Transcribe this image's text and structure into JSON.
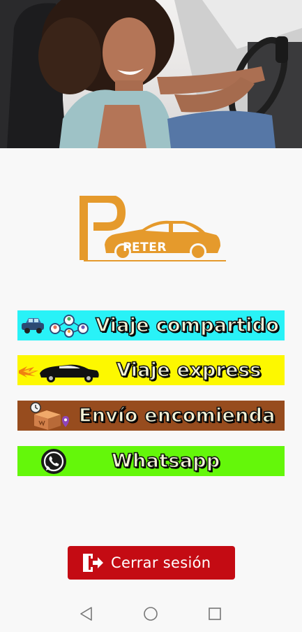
{
  "hero": {
    "image": "woman-driving-car-photo"
  },
  "logo": {
    "letter": "P",
    "text": "PETER",
    "color": "#e59a2c"
  },
  "menu": {
    "items": [
      {
        "label": "Viaje compartido",
        "icon": "shared-ride-icon",
        "color": "#29f2f7"
      },
      {
        "label": "Viaje express",
        "icon": "express-car-icon",
        "color": "#fdf800"
      },
      {
        "label": "Envío encomienda",
        "icon": "parcel-box-icon",
        "color": "#974c1e"
      },
      {
        "label": "Whatsapp",
        "icon": "whatsapp-icon",
        "color": "#64f70a"
      }
    ]
  },
  "logout": {
    "label": "Cerrar sesión",
    "icon": "logout-door-icon",
    "color": "#c40b13"
  },
  "navbar": {
    "buttons": [
      "back-icon",
      "home-icon",
      "recents-icon"
    ]
  }
}
